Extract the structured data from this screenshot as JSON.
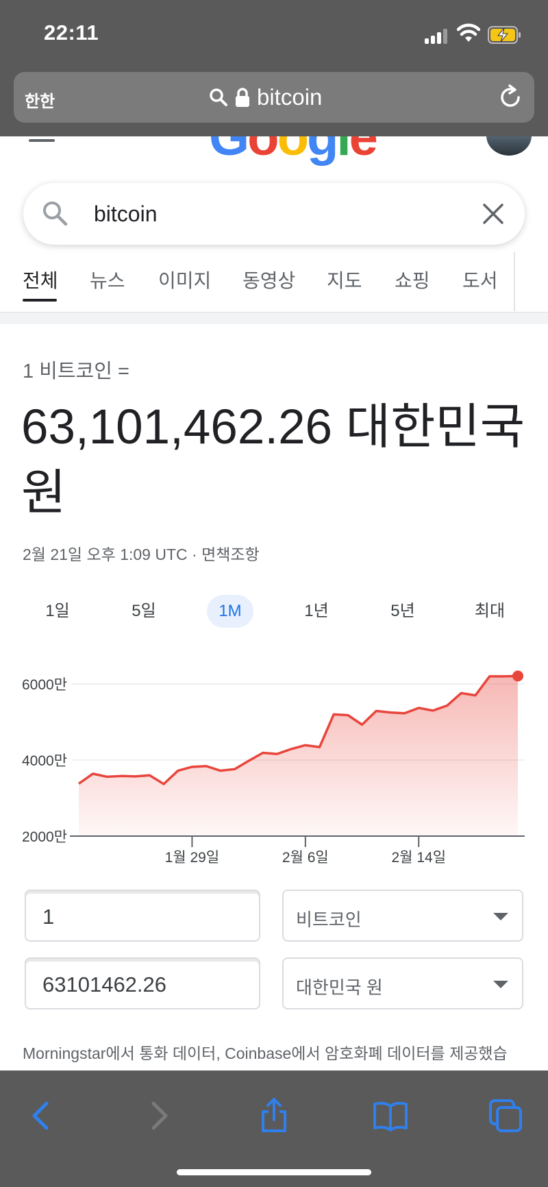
{
  "status_bar": {
    "time": "22:11"
  },
  "browser": {
    "aa_label": "한한",
    "url": "bitcoin"
  },
  "google": {
    "logo": [
      {
        "ch": "G",
        "color": "#4285F4"
      },
      {
        "ch": "o",
        "color": "#EA4335"
      },
      {
        "ch": "o",
        "color": "#FBBC05"
      },
      {
        "ch": "g",
        "color": "#4285F4"
      },
      {
        "ch": "l",
        "color": "#34A853"
      },
      {
        "ch": "e",
        "color": "#EA4335"
      }
    ]
  },
  "search": {
    "query": "bitcoin"
  },
  "tabs": [
    "전체",
    "뉴스",
    "이미지",
    "동영상",
    "지도",
    "쇼핑",
    "도서"
  ],
  "converter": {
    "label": "1 비트코인 =",
    "value": "63,101,462.26 대한민국 원",
    "timestamp": "2월 21일 오후 1:09 UTC",
    "separator": " · ",
    "disclaimer": "면책조항",
    "ranges": [
      "1일",
      "5일",
      "1M",
      "1년",
      "5년",
      "최대"
    ],
    "active_range": "1M",
    "input_amount": "1",
    "input_currency": "비트코인",
    "output_amount": "63101462.26",
    "output_currency": "대한민국 원",
    "attribution": "Morningstar에서 통화 데이터, Coinbase에서 암호화폐 데이터를 제공했습"
  },
  "colors": {
    "line": "#e8453c",
    "active_range_text": "#1a73e8",
    "toolbar_icon_active": "#2f80ed",
    "toolbar_icon_disabled": "#7a7a7a"
  },
  "chart_data": {
    "type": "area",
    "ylim": [
      2000,
      6000
    ],
    "ytick_labels": [
      "6000만",
      "4000만",
      "2000만"
    ],
    "ytick_values": [
      6000,
      4000,
      2000
    ],
    "xtick_labels": [
      "1월 29일",
      "2월 6일",
      "2월 14일"
    ],
    "xtick_positions": [
      8,
      16,
      24
    ],
    "series": [
      {
        "values": [
          3380,
          3640,
          3560,
          3580,
          3570,
          3600,
          3370,
          3720,
          3820,
          3840,
          3720,
          3760,
          3980,
          4190,
          4160,
          4290,
          4390,
          4340,
          5200,
          5180,
          4930,
          5290,
          5250,
          5230,
          5370,
          5300,
          5430,
          5760,
          5700,
          6200,
          6200,
          6210
        ]
      }
    ],
    "grid": true,
    "last_point_marker": true
  }
}
